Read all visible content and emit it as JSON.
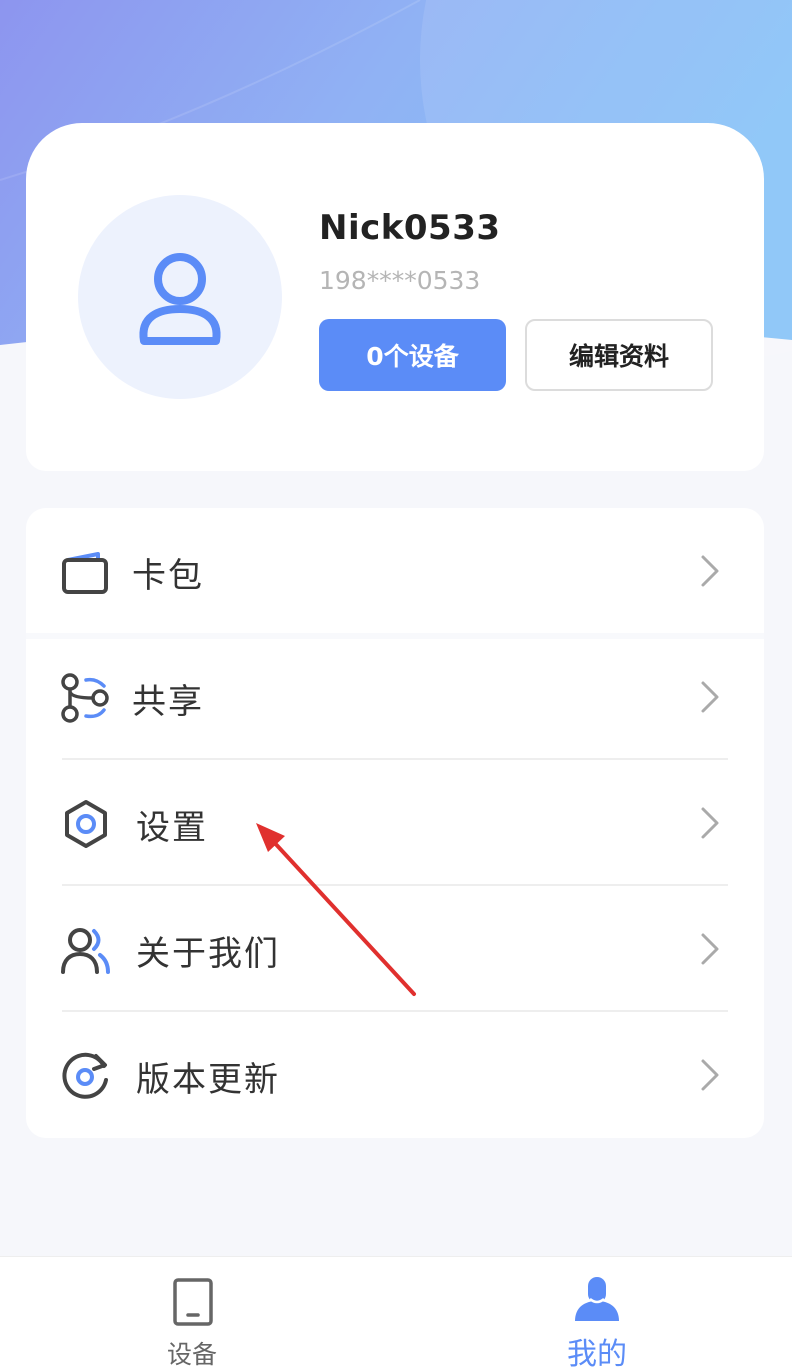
{
  "profile": {
    "username": "Nick0533",
    "phone": "198****0533",
    "devices_button": "0个设备",
    "edit_button": "编辑资料"
  },
  "menu": {
    "items": [
      {
        "label": "卡包",
        "icon": "wallet-icon"
      },
      {
        "label": "共享",
        "icon": "share-icon"
      },
      {
        "label": "设置",
        "icon": "hexagon-settings-icon"
      },
      {
        "label": "关于我们",
        "icon": "users-icon"
      },
      {
        "label": "版本更新",
        "icon": "refresh-icon"
      }
    ]
  },
  "tabbar": {
    "tabs": [
      {
        "label": "设备",
        "icon": "tablet-icon",
        "active": false
      },
      {
        "label": "我的",
        "icon": "person-icon",
        "active": true
      }
    ]
  },
  "colors": {
    "accent": "#5b8cf7",
    "annotation_arrow": "#e0302e",
    "inactive_tab": "#666666",
    "active_tab": "#5b8cf7"
  }
}
